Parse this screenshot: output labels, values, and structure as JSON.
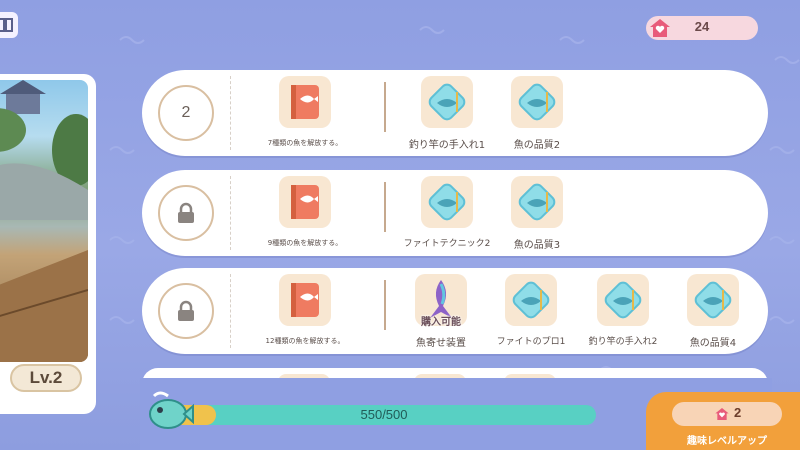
{
  "currency": {
    "value": "24"
  },
  "character": {
    "level": "Lv.2"
  },
  "rows": [
    {
      "level": "2",
      "locked": false,
      "unlock": {
        "caption": "7種類の魚を解放する。"
      },
      "rewards": [
        {
          "caption": "釣り竿の手入れ1"
        },
        {
          "caption": "魚の品質2"
        }
      ]
    },
    {
      "level": "",
      "locked": true,
      "unlock": {
        "caption": "9種類の魚を解放する。"
      },
      "rewards": [
        {
          "caption": "ファイトテクニック2"
        },
        {
          "caption": "魚の品質3"
        }
      ]
    },
    {
      "level": "",
      "locked": true,
      "unlock": {
        "caption": "12種類の魚を解放する。"
      },
      "rewards": [
        {
          "caption": "魚寄せ装置",
          "badge": "購入可能"
        },
        {
          "caption": "ファイトのプロ1"
        },
        {
          "caption": "釣り竿の手入れ2"
        },
        {
          "caption": "魚の品質4"
        }
      ]
    }
  ],
  "xp": {
    "text": "550/500",
    "progress": 1.0
  },
  "levelup": {
    "count": "2",
    "label": "趣味レベルアップ"
  },
  "colors": {
    "accent": "#f2a03b",
    "bar": "#58d0c3",
    "bg": "#8f9fe2"
  }
}
